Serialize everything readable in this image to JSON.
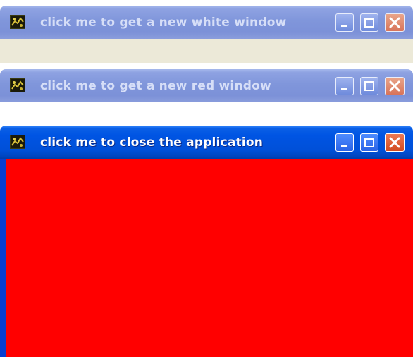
{
  "windows": [
    {
      "title": "click me to get a new white window",
      "state": "inactive",
      "client_color": "#ece9d8"
    },
    {
      "title": "click me to get a new red window",
      "state": "inactive",
      "client_color": "#ffffff"
    },
    {
      "title": "click me to close the application",
      "state": "active",
      "client_color": "#ff0000"
    }
  ],
  "icons": {
    "app": "app-icon",
    "minimize": "minimize-icon",
    "maximize": "maximize-icon",
    "close": "close-icon"
  },
  "colors": {
    "active_title_bar": "#0054e3",
    "inactive_title_bar": "#8096db",
    "close_button": "#d8552a",
    "frame_edge": "#0831d9"
  }
}
